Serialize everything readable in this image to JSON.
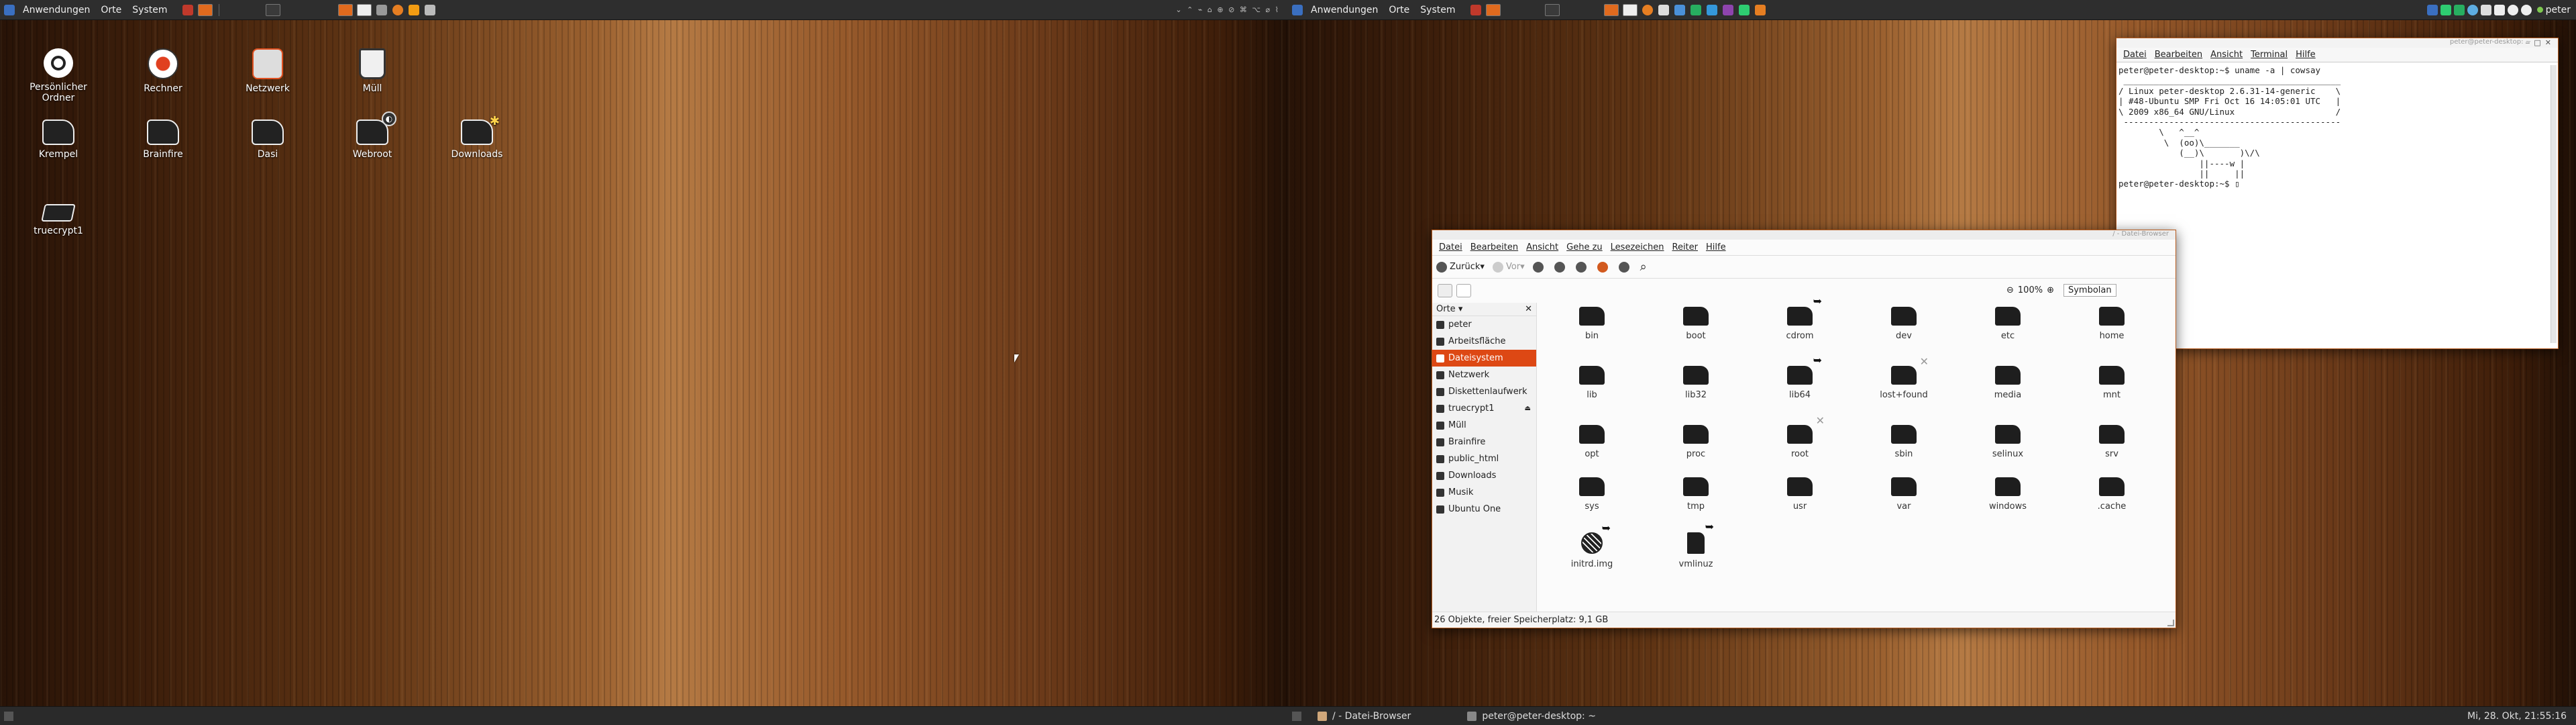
{
  "top_panel_left": {
    "menus": [
      "Anwendungen",
      "Orte",
      "System"
    ],
    "tray_text": "⌄ ⌃ ⌁ ⌂ ⊕ ⊘ ⌘ ⌥ ⌀ ⌇"
  },
  "top_panel_right": {
    "menus": [
      "Anwendungen",
      "Orte",
      "System"
    ],
    "user": "peter"
  },
  "desktop_icons": [
    {
      "label": "Persönlicher Ordner",
      "icon": "home-icon"
    },
    {
      "label": "Rechner",
      "icon": "computer-icon"
    },
    {
      "label": "Netzwerk",
      "icon": "network-icon"
    },
    {
      "label": "Müll",
      "icon": "trash-icon"
    },
    {
      "label": "Krempel",
      "icon": "folder-icon"
    },
    {
      "label": "Brainfire",
      "icon": "folder-icon"
    },
    {
      "label": "Dasi",
      "icon": "folder-icon"
    },
    {
      "label": "Webroot",
      "icon": "folder-icon"
    },
    {
      "label": "Downloads",
      "icon": "folder-icon"
    },
    {
      "label": "truecrypt1",
      "icon": "drive-icon"
    }
  ],
  "terminal": {
    "titlebar": "peter@peter-desktop: ~",
    "menu": [
      "Datei",
      "Bearbeiten",
      "Ansicht",
      "Terminal",
      "Hilfe"
    ],
    "content": "peter@peter-desktop:~$ uname -a | cowsay\n ___________________________________________\n/ Linux peter-desktop 2.6.31-14-generic    \\\n| #48-Ubuntu SMP Fri Oct 16 14:05:01 UTC   |\n\\ 2009 x86_64 GNU/Linux                    /\n -------------------------------------------\n        \\   ^__^\n         \\  (oo)\\_______\n            (__)\\       )\\/\\\n                ||----w |\n                ||     ||\npeter@peter-desktop:~$ ▯"
  },
  "file_browser": {
    "titlebar": "/ - Datei-Browser",
    "menu": [
      "Datei",
      "Bearbeiten",
      "Ansicht",
      "Gehe zu",
      "Lesezeichen",
      "Reiter",
      "Hilfe"
    ],
    "back": "Zurück",
    "forward": "Vor",
    "zoom": "100%",
    "view_mode": "Symbolan",
    "sidebar_header": "Orte",
    "sidebar": [
      {
        "label": "peter"
      },
      {
        "label": "Arbeitsfläche"
      },
      {
        "label": "Dateisystem",
        "selected": true
      },
      {
        "label": "Netzwerk"
      },
      {
        "label": "Diskettenlaufwerk"
      },
      {
        "label": "truecrypt1",
        "eject": true
      },
      {
        "label": "Müll"
      },
      {
        "label": "Brainfire"
      },
      {
        "label": "public_html"
      },
      {
        "label": "Downloads"
      },
      {
        "label": "Musik"
      },
      {
        "label": "Ubuntu One"
      }
    ],
    "files": [
      {
        "name": "bin"
      },
      {
        "name": "boot"
      },
      {
        "name": "cdrom",
        "link": true
      },
      {
        "name": "dev"
      },
      {
        "name": "etc"
      },
      {
        "name": "home"
      },
      {
        "name": "lib"
      },
      {
        "name": "lib32"
      },
      {
        "name": "lib64",
        "link": true
      },
      {
        "name": "lost+found",
        "locked": true
      },
      {
        "name": "media"
      },
      {
        "name": "mnt"
      },
      {
        "name": "opt"
      },
      {
        "name": "proc"
      },
      {
        "name": "root",
        "locked": true
      },
      {
        "name": "sbin"
      },
      {
        "name": "selinux"
      },
      {
        "name": "srv"
      },
      {
        "name": "sys"
      },
      {
        "name": "tmp"
      },
      {
        "name": "usr"
      },
      {
        "name": "var"
      },
      {
        "name": "windows"
      },
      {
        "name": ".cache"
      },
      {
        "name": "initrd.img",
        "link": true,
        "kind": "disk"
      },
      {
        "name": "vmlinuz",
        "link": true,
        "kind": "file"
      }
    ],
    "status": "26 Objekte, freier Speicherplatz: 9,1 GB"
  },
  "bottom_panel_right": {
    "tasks": [
      "/ - Datei-Browser",
      "peter@peter-desktop: ~"
    ],
    "clock": "Mi, 28. Okt, 21:55:16"
  },
  "colors": {
    "accent": "#dd4814",
    "panel": "#2e2e2e"
  }
}
